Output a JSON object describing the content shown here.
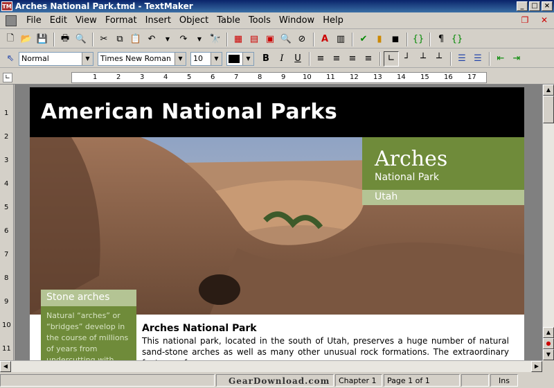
{
  "window": {
    "app_icon": "TM",
    "title": "Arches National Park.tmd - TextMaker"
  },
  "menu": [
    "File",
    "Edit",
    "View",
    "Format",
    "Insert",
    "Object",
    "Table",
    "Tools",
    "Window",
    "Help"
  ],
  "format_bar": {
    "style": "Normal",
    "font": "Times New Roman",
    "size": "10"
  },
  "ruler": {
    "marks": [
      "1",
      "2",
      "3",
      "4",
      "5",
      "6",
      "7",
      "8",
      "9",
      "10",
      "11",
      "12",
      "13",
      "14",
      "15",
      "16",
      "17"
    ],
    "vmarks": [
      "1",
      "2",
      "3",
      "4",
      "5",
      "6",
      "7",
      "8",
      "9",
      "10",
      "11"
    ]
  },
  "page": {
    "header_title": "American National Parks",
    "park_name": "Arches",
    "park_type": "National Park",
    "state": "Utah",
    "sidebar_title": "Stone arches",
    "sidebar_text": "Natural “arches” or “bridges” develop in the course of millions of years from undercutting with",
    "article_title": "Arches National Park",
    "article_text": "This national park, located in the south of Utah, preserves a huge number of natural sand-stone arches as well as many other unusual rock formations. The extraordinary features of"
  },
  "status": {
    "chapter": "Chapter 1",
    "page": "Page 1 of 1",
    "mode": "Ins"
  },
  "watermark": "GearDownload.com"
}
